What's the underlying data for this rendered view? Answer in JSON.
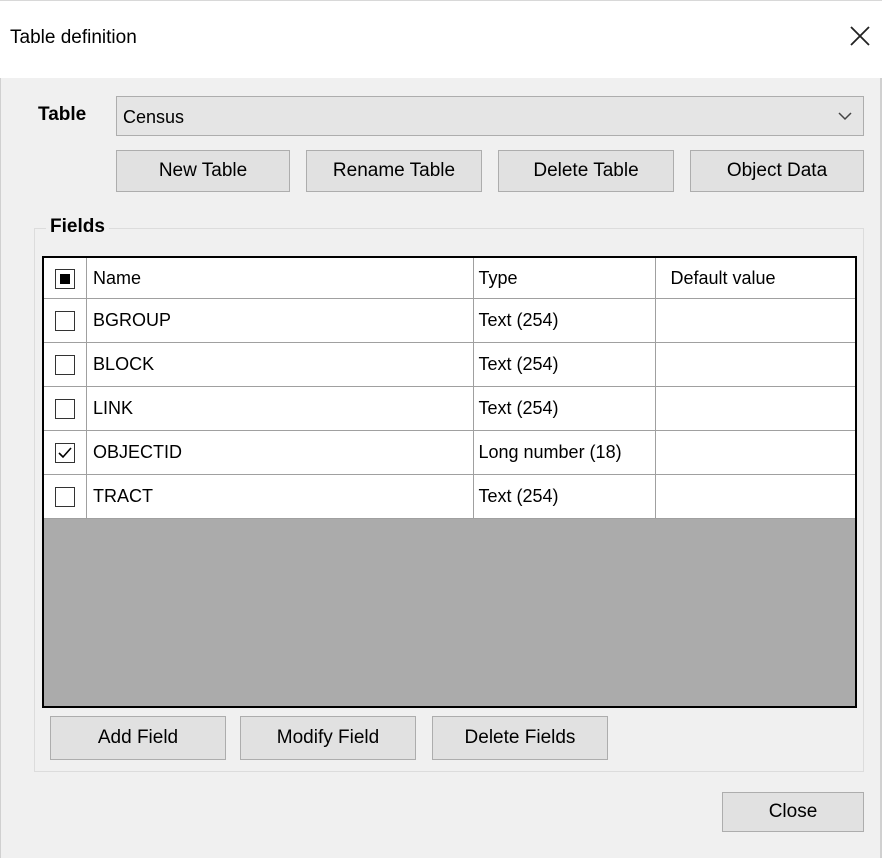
{
  "window": {
    "title": "Table definition",
    "close_icon": "close-icon"
  },
  "table_selector": {
    "label": "Table",
    "value": "Census"
  },
  "table_buttons": {
    "new": "New Table",
    "rename": "Rename Table",
    "delete": "Delete Table",
    "object_data": "Object Data"
  },
  "fields": {
    "group_label": "Fields",
    "columns": {
      "name": "Name",
      "type": "Type",
      "default": "Default value"
    },
    "rows": [
      {
        "name": "BGROUP",
        "type": "Text (254)",
        "default": "",
        "checked": false
      },
      {
        "name": "BLOCK",
        "type": "Text (254)",
        "default": "",
        "checked": false
      },
      {
        "name": "LINK",
        "type": "Text (254)",
        "default": "",
        "checked": false
      },
      {
        "name": "OBJECTID",
        "type": "Long number (18)",
        "default": "",
        "checked": true
      },
      {
        "name": "TRACT",
        "type": "Text (254)",
        "default": "",
        "checked": false
      }
    ],
    "buttons": {
      "add": "Add Field",
      "modify": "Modify Field",
      "delete": "Delete Fields"
    }
  },
  "footer": {
    "close": "Close"
  }
}
